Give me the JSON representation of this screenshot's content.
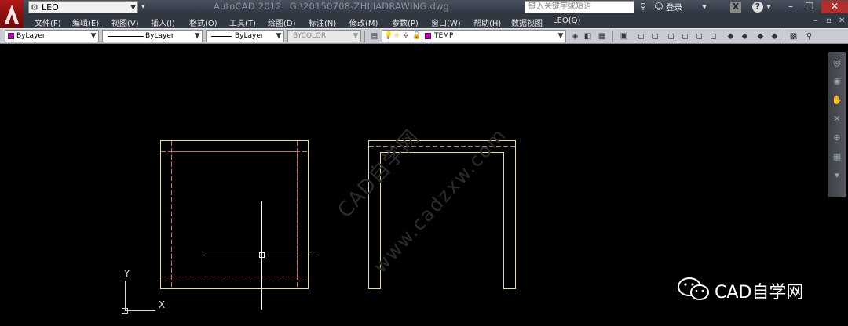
{
  "titlebar": {
    "workspace": "LEO",
    "app_name": "AutoCAD 2012",
    "file_path": "G:\\20150708-ZHIJIADRAWING.dwg",
    "search_placeholder": "键入关键字或短语",
    "login_label": "登录"
  },
  "menu": [
    {
      "label": "文件(F)"
    },
    {
      "label": "编辑(E)"
    },
    {
      "label": "视图(V)"
    },
    {
      "label": "插入(I)"
    },
    {
      "label": "格式(O)"
    },
    {
      "label": "工具(T)"
    },
    {
      "label": "绘图(D)"
    },
    {
      "label": "标注(N)"
    },
    {
      "label": "修改(M)"
    },
    {
      "label": "参数(P)"
    },
    {
      "label": "窗口(W)"
    },
    {
      "label": "帮助(H)"
    },
    {
      "label": "数据视图"
    },
    {
      "label": "LEO(Q)"
    }
  ],
  "properties": {
    "color": "ByLayer",
    "linetype": "ByLayer",
    "lineweight": "ByLayer",
    "plotstyle": "BYCOLOR",
    "layer": "TEMP",
    "layer_color": "#c000c0"
  },
  "ucs": {
    "x_label": "X",
    "y_label": "Y"
  },
  "watermark": {
    "line1": "CAD自学网",
    "line2": "www.cadzxw.com"
  },
  "brand": {
    "name": "CAD自学网"
  },
  "colors": {
    "background": "#000000",
    "outline": "#e6dca0",
    "hidden_line": "#b07a70",
    "crosshair": "#ffffff"
  }
}
